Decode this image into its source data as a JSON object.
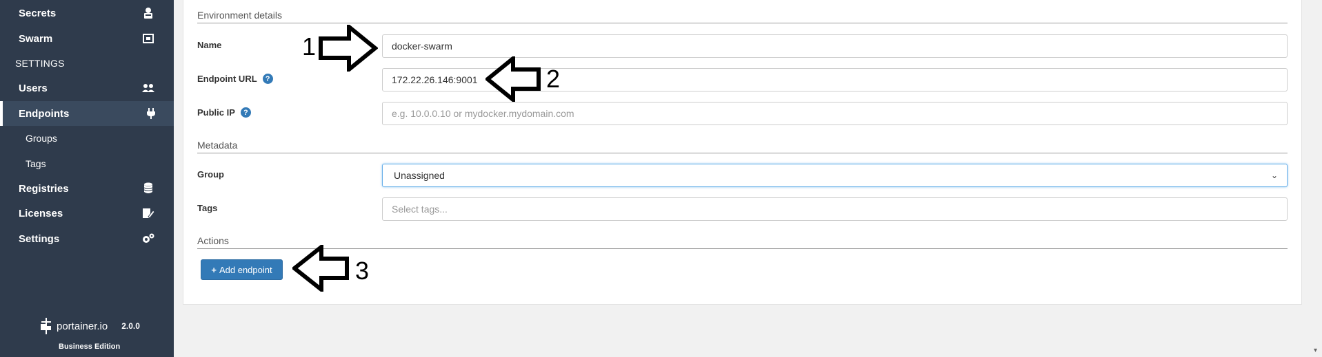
{
  "sidebar": {
    "items_top": [
      {
        "label": "Secrets",
        "icon": "secrets-icon"
      },
      {
        "label": "Swarm",
        "icon": "swarm-icon"
      }
    ],
    "settings_header": "SETTINGS",
    "users_label": "Users",
    "endpoints_label": "Endpoints",
    "groups_label": "Groups",
    "tags_label": "Tags",
    "registries_label": "Registries",
    "licenses_label": "Licenses",
    "settings_label": "Settings",
    "brand": "portainer.io",
    "version": "2.0.0",
    "edition": "Business Edition"
  },
  "form": {
    "environment_title": "Environment details",
    "name_label": "Name",
    "name_value": "docker-swarm",
    "endpoint_url_label": "Endpoint URL",
    "endpoint_url_value": "172.22.26.146:9001",
    "public_ip_label": "Public IP",
    "public_ip_placeholder": "e.g. 10.0.0.10 or mydocker.mydomain.com",
    "metadata_title": "Metadata",
    "group_label": "Group",
    "group_value": "Unassigned",
    "tags_label": "Tags",
    "tags_placeholder": "Select tags...",
    "actions_title": "Actions",
    "add_endpoint_label": "Add endpoint"
  },
  "annotations": {
    "one": "1",
    "two": "2",
    "three": "3"
  }
}
